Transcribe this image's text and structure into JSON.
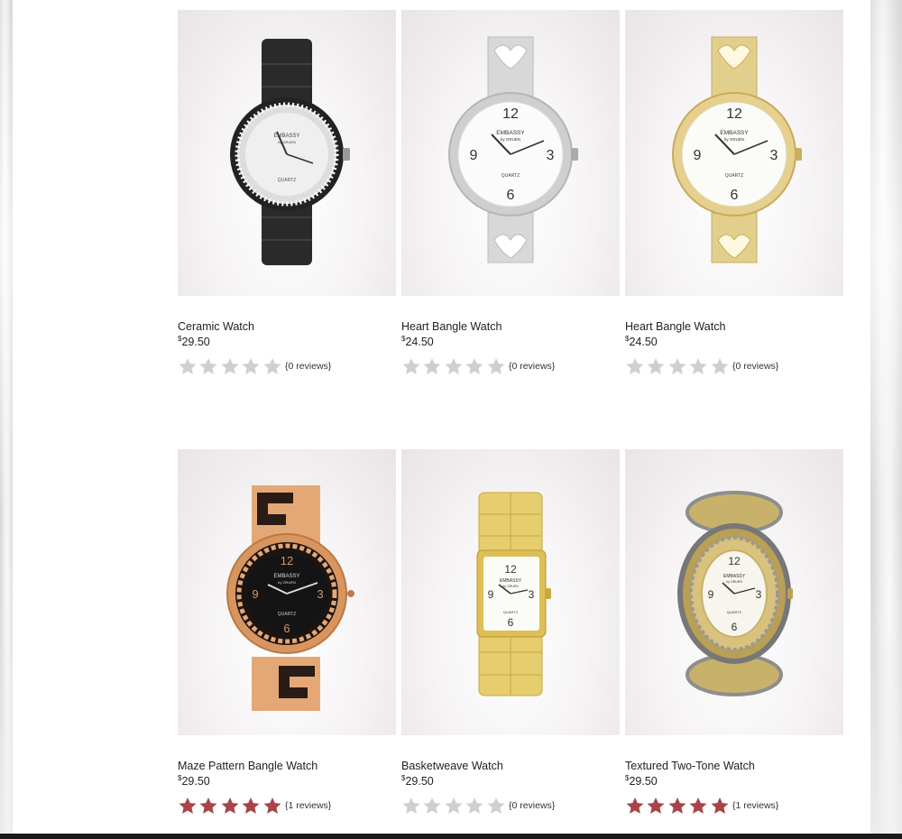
{
  "colors": {
    "star_filled": "#a8434b",
    "star_empty": "#cfcfcf"
  },
  "products": [
    {
      "name": "Ceramic Watch",
      "price_symbol": "$",
      "price_amount": "29.50",
      "rating": 0,
      "reviews": "{0 reviews}",
      "image_icon": "black-ceramic-watch-icon"
    },
    {
      "name": "Heart Bangle Watch",
      "price_symbol": "$",
      "price_amount": "24.50",
      "rating": 0,
      "reviews": "{0 reviews}",
      "image_icon": "silver-bangle-watch-icon"
    },
    {
      "name": "Heart Bangle Watch",
      "price_symbol": "$",
      "price_amount": "24.50",
      "rating": 0,
      "reviews": "{0 reviews}",
      "image_icon": "gold-bangle-watch-icon"
    },
    {
      "name": "Maze Pattern Bangle Watch",
      "price_symbol": "$",
      "price_amount": "29.50",
      "rating": 5,
      "reviews": "{1 reviews}",
      "image_icon": "maze-bangle-watch-icon"
    },
    {
      "name": "Basketweave Watch",
      "price_symbol": "$",
      "price_amount": "29.50",
      "rating": 0,
      "reviews": "{0 reviews}",
      "image_icon": "basketweave-watch-icon"
    },
    {
      "name": "Textured Two-Tone Watch",
      "price_symbol": "$",
      "price_amount": "29.50",
      "rating": 5,
      "reviews": "{1 reviews}",
      "image_icon": "two-tone-watch-icon"
    }
  ],
  "watch_brand": {
    "line1": "EMBASSY",
    "line2": "by GRUEN",
    "line3": "QUARTZ"
  }
}
